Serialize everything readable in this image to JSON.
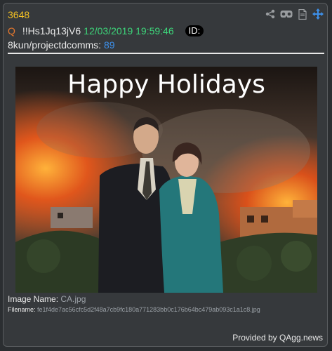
{
  "post": {
    "number": "3648",
    "author_prefix": "Q",
    "tripcode": "!!Hs1Jq13jV6",
    "timestamp": "12/03/2019 19:59:46",
    "id_label": "ID:",
    "board": "8kun/projectdcomms:",
    "board_post_number": "89"
  },
  "toolbar": {
    "icons": [
      "share-icon",
      "vr-headset-icon",
      "document-icon",
      "move-arrows-icon"
    ]
  },
  "image": {
    "overlay_text": "Happy Holidays"
  },
  "meta": {
    "image_name_label": "Image Name:",
    "image_name_value": "CA.jpg",
    "filename_label": "Filename:",
    "filename_value": "fe1f4de7ac56cfc5d2f48a7cb9fc180a771283bb0c176b64bc479ab093c1a1c8.jpg"
  },
  "footer": {
    "provided_by": "Provided by QAgg.news"
  },
  "colors": {
    "post_number": "#f3c024",
    "q_letter": "#e6782e",
    "timestamp": "#3dd67a",
    "board_number": "#3d8fe8",
    "move_icon": "#3d8fe8"
  }
}
